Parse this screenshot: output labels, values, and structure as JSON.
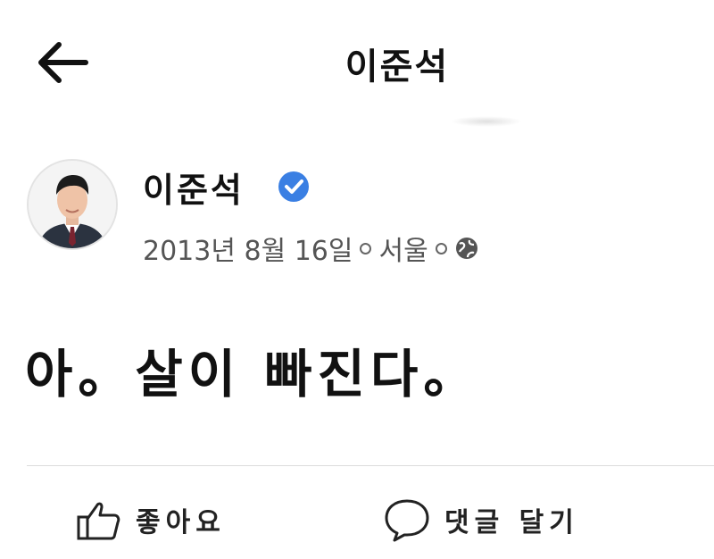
{
  "header": {
    "title": "이준석"
  },
  "post": {
    "author": "이준석",
    "date": "2013년 8월 16일",
    "location": "서울",
    "text": "아。살이 빠진다。"
  },
  "actions": {
    "like": "좋아요",
    "comment": "댓글 달기"
  },
  "icons": {
    "back": "back-arrow-icon",
    "verified": "verified-badge-icon",
    "globe": "globe-icon",
    "like": "thumbs-up-icon",
    "comment": "comment-bubble-icon"
  },
  "colors": {
    "verified": "#3a7fe3",
    "meta_text": "#555555",
    "divider": "#dcdcdc"
  }
}
